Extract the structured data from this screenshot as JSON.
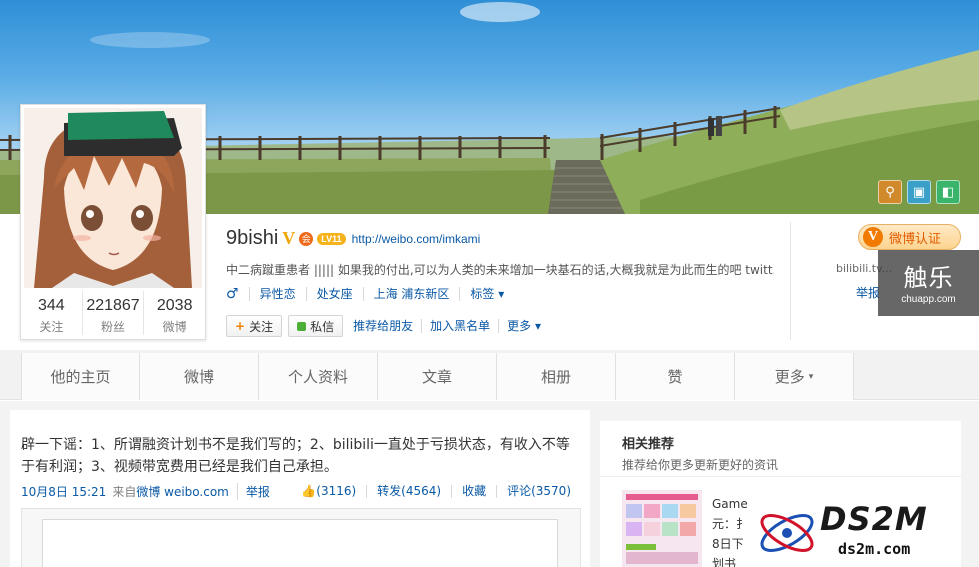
{
  "banner": {
    "icons": [
      {
        "name": "location-icon",
        "color": "#d08a2c",
        "glyph": "⚲"
      },
      {
        "name": "photo-icon",
        "color": "#3aa0c8",
        "glyph": "▣"
      },
      {
        "name": "template-icon",
        "color": "#3ab46a",
        "glyph": "◧"
      }
    ]
  },
  "profile": {
    "stats": [
      {
        "value": "344",
        "label": "关注"
      },
      {
        "value": "221867",
        "label": "粉丝"
      },
      {
        "value": "2038",
        "label": "微博"
      }
    ],
    "name": "9bishi",
    "v_badge": "V",
    "member_icon": "会",
    "level": "LV11",
    "url": "http://weibo.com/imkami",
    "bio": "中二病蹴重患者 |||||  如果我的付出,可以为人类的未来增加一块基石的话,大概我就是为此而生的吧  twitt...",
    "gender_symbol": "♂",
    "orientation": "异性恋",
    "zodiac": "处女座",
    "location": "上海 浦东新区",
    "tags_label": "标签",
    "buttons": {
      "follow_plus": "+",
      "follow": "关注",
      "message": "私信",
      "recommend": "推荐给朋友",
      "blacklist": "加入黑名单",
      "more": "更多"
    },
    "verified_label": "微博认证",
    "verified_v": "V",
    "verified_desc": "bilibili.tv...",
    "report_label": "举报"
  },
  "watermarks": {
    "chuapp_big": "触乐",
    "chuapp_small": "chuapp.com",
    "ds2m_logo": "DS2M",
    "ds2m_domain": "ds2m.com"
  },
  "tabs": [
    {
      "label": "他的主页"
    },
    {
      "label": "微博"
    },
    {
      "label": "个人资料"
    },
    {
      "label": "文章"
    },
    {
      "label": "相册"
    },
    {
      "label": "赞"
    },
    {
      "label": "更多",
      "caret": "▾"
    }
  ],
  "post": {
    "text": "辟一下谣：1、所谓融资计划书不是我们写的；2、bilibili一直处于亏损状态，有收入不等于有利润；3、视频带宽费用已经是我们自己承担。",
    "time": "10月8日 15:21",
    "from_prefix": "来自",
    "source": "微博 weibo.com",
    "report": "举报",
    "likes": "(3116)",
    "repost": "转发(4564)",
    "favorite": "收藏",
    "comment": "评论(3570)"
  },
  "sidebar": {
    "title": "相关推荐",
    "subtitle": "推荐给你更多更新更好的资讯",
    "items": [
      "Game",
      "元：扌",
      "8日下",
      "划书"
    ]
  }
}
